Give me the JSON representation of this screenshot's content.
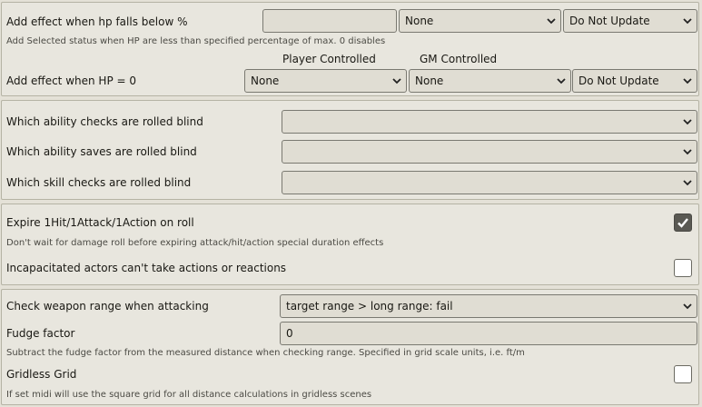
{
  "hp_section": {
    "below_label": "Add effect when hp falls below %",
    "below_value": "",
    "below_status": "None",
    "below_update": "Do Not Update",
    "below_hint": "Add Selected status when HP are less than specified percentage of max. 0 disables",
    "player_heading": "Player Controlled",
    "gm_heading": "GM Controlled",
    "zero_label": "Add effect when HP = 0",
    "zero_player": "None",
    "zero_gm": "None",
    "zero_update": "Do Not Update"
  },
  "blind_section": {
    "ability_checks_label": "Which ability checks are rolled blind",
    "ability_checks_value": "",
    "ability_saves_label": "Which ability saves are rolled blind",
    "ability_saves_value": "",
    "skill_checks_label": "Which skill checks are rolled blind",
    "skill_checks_value": ""
  },
  "expire_section": {
    "expire_label": "Expire 1Hit/1Attack/1Action on roll",
    "expire_checked": true,
    "expire_hint": "Don't wait for damage roll before expiring attack/hit/action special duration effects",
    "incap_label": "Incapacitated actors can't take actions or reactions",
    "incap_checked": false
  },
  "range_section": {
    "weapon_range_label": "Check weapon range when attacking",
    "weapon_range_value": "target range > long range: fail",
    "fudge_label": "Fudge factor",
    "fudge_value": "0",
    "fudge_hint": "Subtract the fudge factor from the measured distance when checking range. Specified in grid scale units, i.e. ft/m",
    "gridless_label": "Gridless Grid",
    "gridless_checked": false,
    "gridless_hint": "If set midi will use the square grid for all distance calculations in gridless scenes"
  }
}
